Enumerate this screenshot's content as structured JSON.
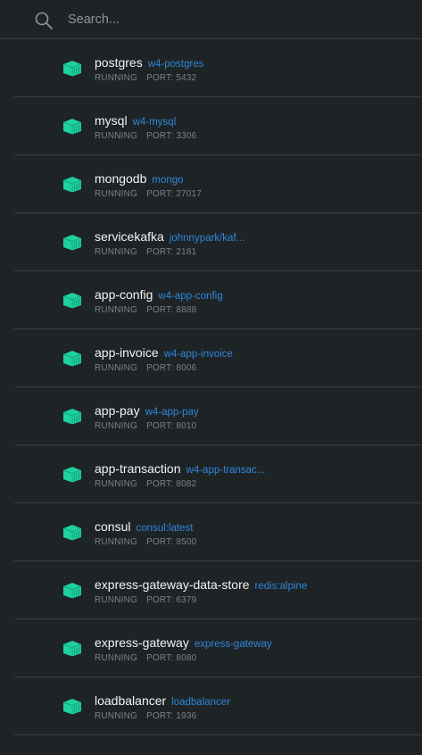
{
  "search": {
    "placeholder": "Search..."
  },
  "colors": {
    "background": "#1e2325",
    "divider": "#3a4042",
    "container_icon": "#1fd1a0",
    "image_link": "#2f86d9",
    "status_text": "#7b8284"
  },
  "containers": [
    {
      "name": "postgres",
      "image": "w4-postgres",
      "status": "RUNNING",
      "port": "PORT: 5432",
      "icon": "container-icon"
    },
    {
      "name": "mysql",
      "image": "w4-mysql",
      "status": "RUNNING",
      "port": "PORT: 3306",
      "icon": "container-icon"
    },
    {
      "name": "mongodb",
      "image": "mongo",
      "status": "RUNNING",
      "port": "PORT: 27017",
      "icon": "container-icon"
    },
    {
      "name": "servicekafka",
      "image": "johnnypark/kaf...",
      "status": "RUNNING",
      "port": "PORT: 2181",
      "icon": "container-icon"
    },
    {
      "name": "app-config",
      "image": "w4-app-config",
      "status": "RUNNING",
      "port": "PORT: 8888",
      "icon": "container-icon"
    },
    {
      "name": "app-invoice",
      "image": "w4-app-invoice",
      "status": "RUNNING",
      "port": "PORT: 8006",
      "icon": "container-icon"
    },
    {
      "name": "app-pay",
      "image": "w4-app-pay",
      "status": "RUNNING",
      "port": "PORT: 8010",
      "icon": "container-icon"
    },
    {
      "name": "app-transaction",
      "image": "w4-app-transac...",
      "status": "RUNNING",
      "port": "PORT: 8082",
      "icon": "container-icon"
    },
    {
      "name": "consul",
      "image": "consul:latest",
      "status": "RUNNING",
      "port": "PORT: 8500",
      "icon": "container-icon"
    },
    {
      "name": "express-gateway-data-store",
      "image": "redis:alpine",
      "status": "RUNNING",
      "port": "PORT: 6379",
      "icon": "container-icon"
    },
    {
      "name": "express-gateway",
      "image": "express-gateway",
      "status": "RUNNING",
      "port": "PORT: 8080",
      "icon": "container-icon"
    },
    {
      "name": "loadbalancer",
      "image": "loadbalancer",
      "status": "RUNNING",
      "port": "PORT: 1936",
      "icon": "container-icon"
    }
  ]
}
